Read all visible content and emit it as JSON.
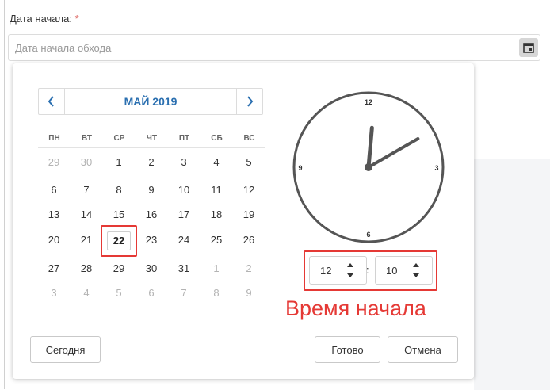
{
  "field": {
    "label": "Дата начала:",
    "required_mark": "*",
    "placeholder": "Дата начала обхода",
    "calendar_icon": "calendar-icon"
  },
  "calendar": {
    "prev_icon": "chevron-left-icon",
    "next_icon": "chevron-right-icon",
    "month_title": "МАЙ 2019",
    "weekdays": [
      "ПН",
      "ВТ",
      "СР",
      "ЧТ",
      "ПТ",
      "СБ",
      "ВС"
    ],
    "weeks": [
      [
        "29",
        "30",
        "1",
        "2",
        "3",
        "4",
        "5"
      ],
      [
        "6",
        "7",
        "8",
        "9",
        "10",
        "11",
        "12"
      ],
      [
        "13",
        "14",
        "15",
        "16",
        "17",
        "18",
        "19"
      ],
      [
        "20",
        "21",
        "22",
        "23",
        "24",
        "25",
        "26"
      ],
      [
        "27",
        "28",
        "29",
        "30",
        "31",
        "1",
        "2"
      ],
      [
        "3",
        "4",
        "5",
        "6",
        "7",
        "8",
        "9"
      ]
    ],
    "selected_day": "22"
  },
  "clock": {
    "labels": {
      "top": "12",
      "right": "3",
      "bottom": "6",
      "left": "9"
    },
    "hour": 12,
    "minute": 10
  },
  "time": {
    "hours": "12",
    "minutes": "10",
    "separator": ":",
    "caption": "Время начала"
  },
  "buttons": {
    "today": "Сегодня",
    "done": "Готово",
    "cancel": "Отмена"
  },
  "colors": {
    "accent": "#2a6fb0",
    "highlight": "#e53935"
  }
}
